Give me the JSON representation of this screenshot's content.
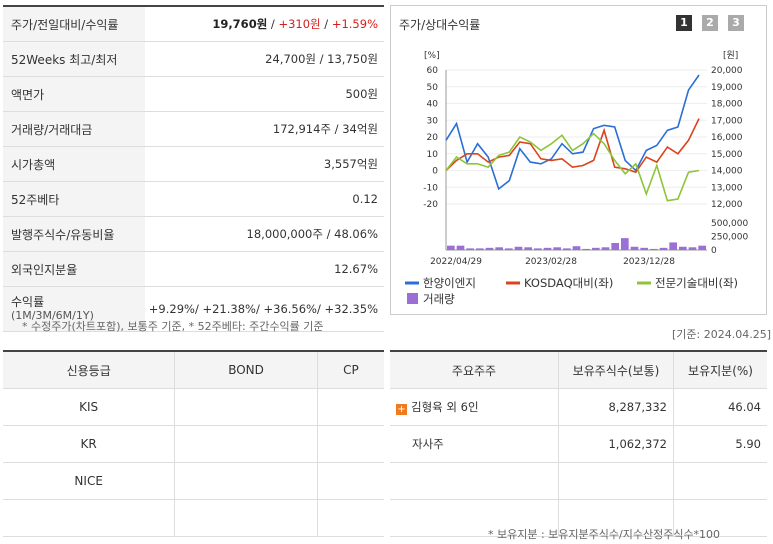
{
  "summary": {
    "rows": [
      {
        "label": "주가/전일대비/수익률",
        "price": "19,760원",
        "change": "+310원",
        "rate": "+1.59%"
      },
      {
        "label": "52Weeks 최고/최저",
        "value": "24,700원 / 13,750원"
      },
      {
        "label": "액면가",
        "value": "500원"
      },
      {
        "label": "거래량/거래대금",
        "value": "172,914주 / 34억원"
      },
      {
        "label": "시가총액",
        "value": "3,557억원"
      },
      {
        "label": "52주베타",
        "value": "0.12"
      },
      {
        "label": "발행주식수/유동비율",
        "value": "18,000,000주 / 48.06%"
      },
      {
        "label": "외국인지분율",
        "value": "12.67%"
      }
    ],
    "returns": {
      "label": "수익률",
      "sub": "(1M/3M/6M/1Y)",
      "value": "+9.29%/ +21.38%/ +36.56%/ +32.35%"
    },
    "note": "* 수정주가(차트포함), 보통주 기준, * 52주베타: 주간수익률 기준"
  },
  "credit": {
    "headers": [
      "신용등급",
      "BOND",
      "CP"
    ],
    "rows": [
      [
        "KIS",
        "",
        ""
      ],
      [
        "KR",
        "",
        ""
      ],
      [
        "NICE",
        "",
        ""
      ],
      [
        "",
        "",
        ""
      ]
    ]
  },
  "chart_panel": {
    "title": "주가/상대수익률",
    "pages": [
      "1",
      "2",
      "3"
    ],
    "left_unit": "[%]",
    "right_unit": "[원]"
  },
  "chart_data": {
    "type": "line",
    "x": [
      "2022/04/29",
      "",
      "",
      "",
      "",
      "",
      "",
      "",
      "",
      "",
      "",
      "2023/02/28",
      "",
      "",
      "",
      "",
      "",
      "",
      "",
      "",
      "",
      "2023/12/28",
      "",
      "",
      "",
      "",
      "",
      ""
    ],
    "xtick_labels": [
      "2022/04/29",
      "2023/02/28",
      "2023/12/28"
    ],
    "ylim_left": [
      -20,
      60
    ],
    "yticks_left": [
      60,
      50,
      40,
      30,
      20,
      10,
      0,
      -10,
      -20
    ],
    "ylim_right": [
      12000,
      20000
    ],
    "yticks_right": [
      "20,000",
      "19,000",
      "18,000",
      "17,000",
      "16,000",
      "15,000",
      "14,000",
      "13,000",
      "12,000"
    ],
    "volume_ticks": [
      "500,000",
      "250,000",
      "0"
    ],
    "volume_max": 500000,
    "series": [
      {
        "name": "한양이엔지",
        "color": "#2a6fd6",
        "values": [
          18,
          28,
          5,
          16,
          8,
          -11,
          -6,
          13,
          5,
          4,
          7,
          16,
          10,
          11,
          25,
          27,
          26,
          6,
          0,
          12,
          15,
          24,
          26,
          48,
          57
        ]
      },
      {
        "name": "KOSDAQ대비(좌)",
        "color": "#d9441c",
        "values": [
          0,
          6,
          10,
          10,
          5,
          8,
          9,
          17,
          16,
          7,
          6,
          7,
          2,
          3,
          6,
          24,
          2,
          1,
          -1,
          8,
          5,
          14,
          10,
          18,
          31
        ]
      },
      {
        "name": "전문기술대비(좌)",
        "color": "#8ec43a",
        "values": [
          0,
          8,
          4,
          4,
          2,
          9,
          11,
          20,
          17,
          12,
          16,
          21,
          12,
          16,
          22,
          16,
          6,
          -2,
          4,
          -14,
          3,
          -18,
          -17,
          -1,
          0
        ]
      },
      {
        "name": "거래량",
        "color": "#9b6fd6",
        "type": "bar",
        "values": [
          80000,
          80000,
          30000,
          30000,
          40000,
          50000,
          30000,
          60000,
          50000,
          30000,
          40000,
          50000,
          30000,
          70000,
          20000,
          40000,
          50000,
          130000,
          220000,
          60000,
          40000,
          20000,
          40000,
          140000,
          60000,
          50000,
          80000
        ]
      }
    ]
  },
  "date_note": "[기준: 2024.04.25]",
  "holders": {
    "headers": [
      "주요주주",
      "보유주식수(보통)",
      "보유지분(%)"
    ],
    "rows": [
      {
        "name": "김형육 외 6인",
        "shares": "8,287,332",
        "pct": "46.04",
        "expand": "+"
      },
      {
        "name": "자사주",
        "shares": "1,062,372",
        "pct": "5.90"
      },
      {
        "name": "",
        "shares": "",
        "pct": ""
      },
      {
        "name": "",
        "shares": "",
        "pct": ""
      }
    ],
    "note": "* 보유지분 : 보유지분주식수/지수산정주식수*100"
  }
}
